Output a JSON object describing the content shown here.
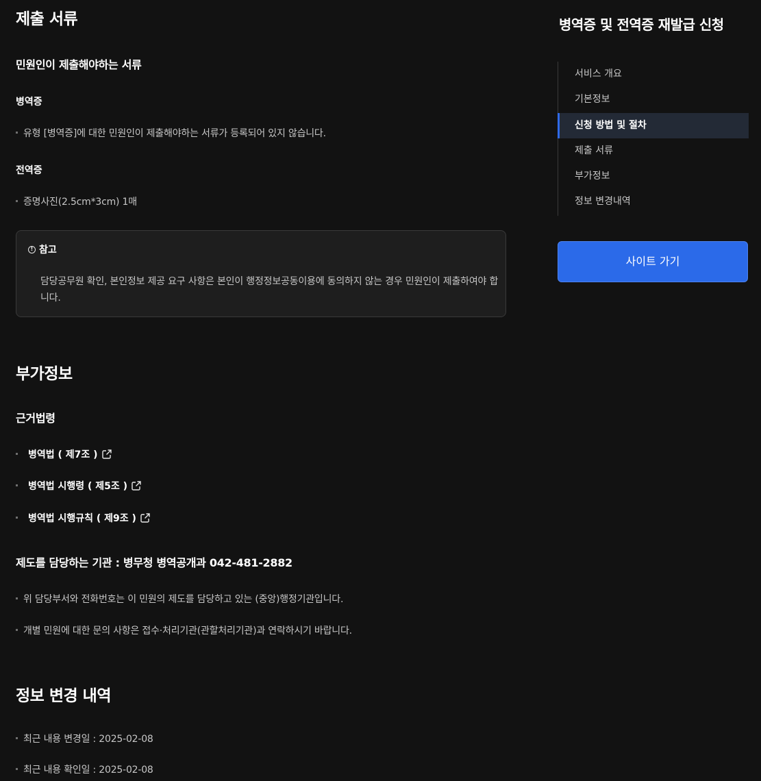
{
  "submit_docs": {
    "heading": "제출 서류",
    "subheading": "민원인이 제출해야하는 서류",
    "groups": [
      {
        "title": "병역증",
        "items": [
          "유형 [병역증]에 대한 민원인이 제출해야하는 서류가 등록되어 있지 않습니다."
        ]
      },
      {
        "title": "전역증",
        "items": [
          "증명사진(2.5cm*3cm) 1매"
        ]
      }
    ],
    "note": {
      "icon": "info-icon",
      "title": "참고",
      "body": "담당공무원 확인, 본인정보 제공 요구 사항은 본인이 행정정보공동이용에 동의하지 않는 경우 민원인이 제출하여야 합니다."
    }
  },
  "extra_info": {
    "heading": "부가정보",
    "laws_heading": "근거법령",
    "laws": [
      "병역법 ( 제7조 )",
      "병역법 시행령 ( 제5조 )",
      "병역법 시행규칙 ( 제9조 )"
    ],
    "agency": "제도를 담당하는 기관 : 병무청  병역공개과 042-481-2882",
    "notes": [
      "위 담당부서와 전화번호는 이 민원의 제도를 담당하고 있는 (중앙)행정기관입니다.",
      "개별 민원에 대한 문의 사항은 접수·처리기관(관할처리기관)과 연락하시기 바랍니다."
    ]
  },
  "change_history": {
    "heading": "정보 변경 내역",
    "items": [
      "최근 내용 변경일 : 2025-02-08",
      "최근 내용 확인일 : 2025-02-08"
    ]
  },
  "sidebar": {
    "title": "병역증 및 전역증 재발급 신청",
    "toc": [
      "서비스 개요",
      "기본정보",
      "신청 방법 및 절차",
      "제출 서류",
      "부가정보",
      "정보 변경내역"
    ],
    "active_index": 2,
    "button_label": "사이트 가기"
  },
  "colors": {
    "background": "#121212",
    "accent": "#2b6ae9",
    "active_bg": "#232a36"
  }
}
